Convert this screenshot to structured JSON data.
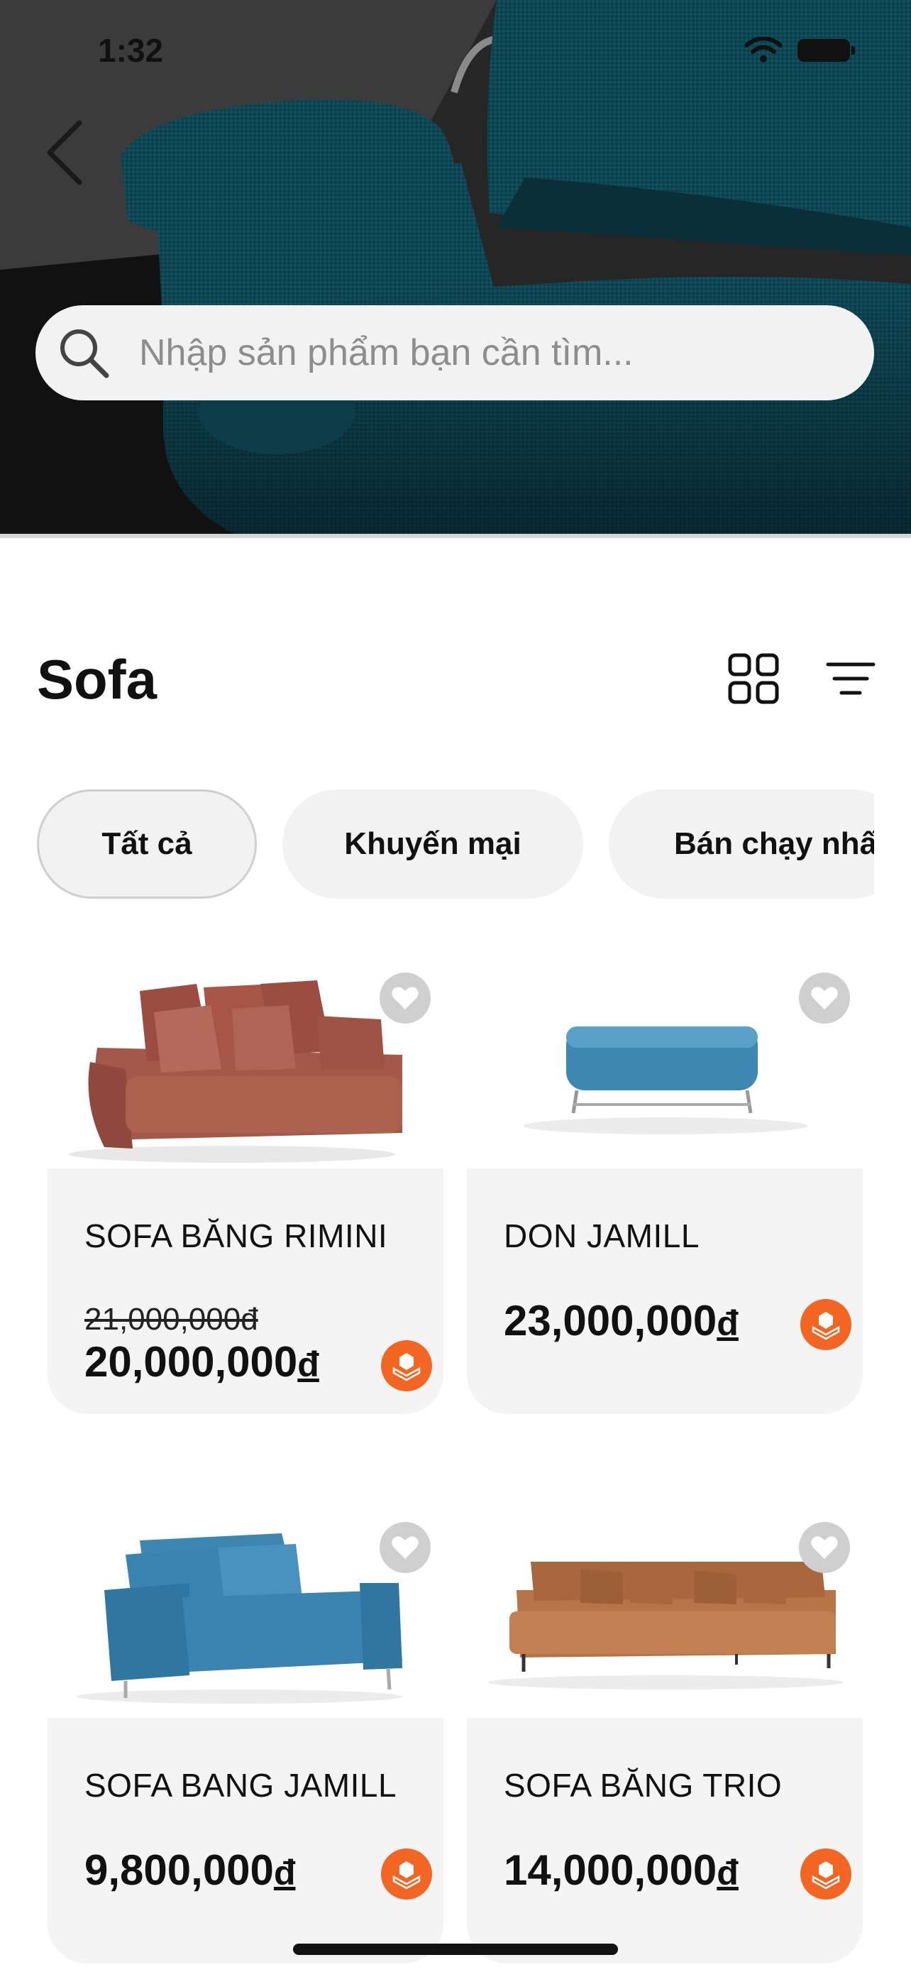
{
  "status_bar": {
    "time": "1:32"
  },
  "search": {
    "placeholder": "Nhập sản phẩm bạn cần tìm..."
  },
  "page": {
    "title": "Sofa"
  },
  "tabs": [
    {
      "label": "Tất cả",
      "active": true
    },
    {
      "label": "Khuyến mại",
      "active": false
    },
    {
      "label": "Bán chạy nhất",
      "active": false
    }
  ],
  "products": [
    {
      "name": "SOFA BĂNG RIMINI",
      "old_price": "21,000,000đ",
      "price": "20,000,000",
      "currency": "đ",
      "color": "#a55a48"
    },
    {
      "name": "DON JAMILL",
      "price": "23,000,000",
      "currency": "đ",
      "color": "#3f88b3"
    },
    {
      "name": "SOFA BANG JAMILL",
      "price": "9,800,000",
      "currency": "đ",
      "color": "#3b83b0"
    },
    {
      "name": "SOFA BĂNG TRIO",
      "price": "14,000,000",
      "currency": "đ",
      "color": "#b77448"
    }
  ],
  "colors": {
    "accent": "#f26522",
    "card_bg": "#f4f4f4",
    "tab_bg": "#f2f2f2",
    "hero_sofa": "#0d4552"
  },
  "icons": [
    "back-chevron-icon",
    "search-icon",
    "grid-view-icon",
    "filter-lines-icon",
    "heart-icon",
    "cart-3d-icon",
    "wifi-icon",
    "battery-icon"
  ]
}
